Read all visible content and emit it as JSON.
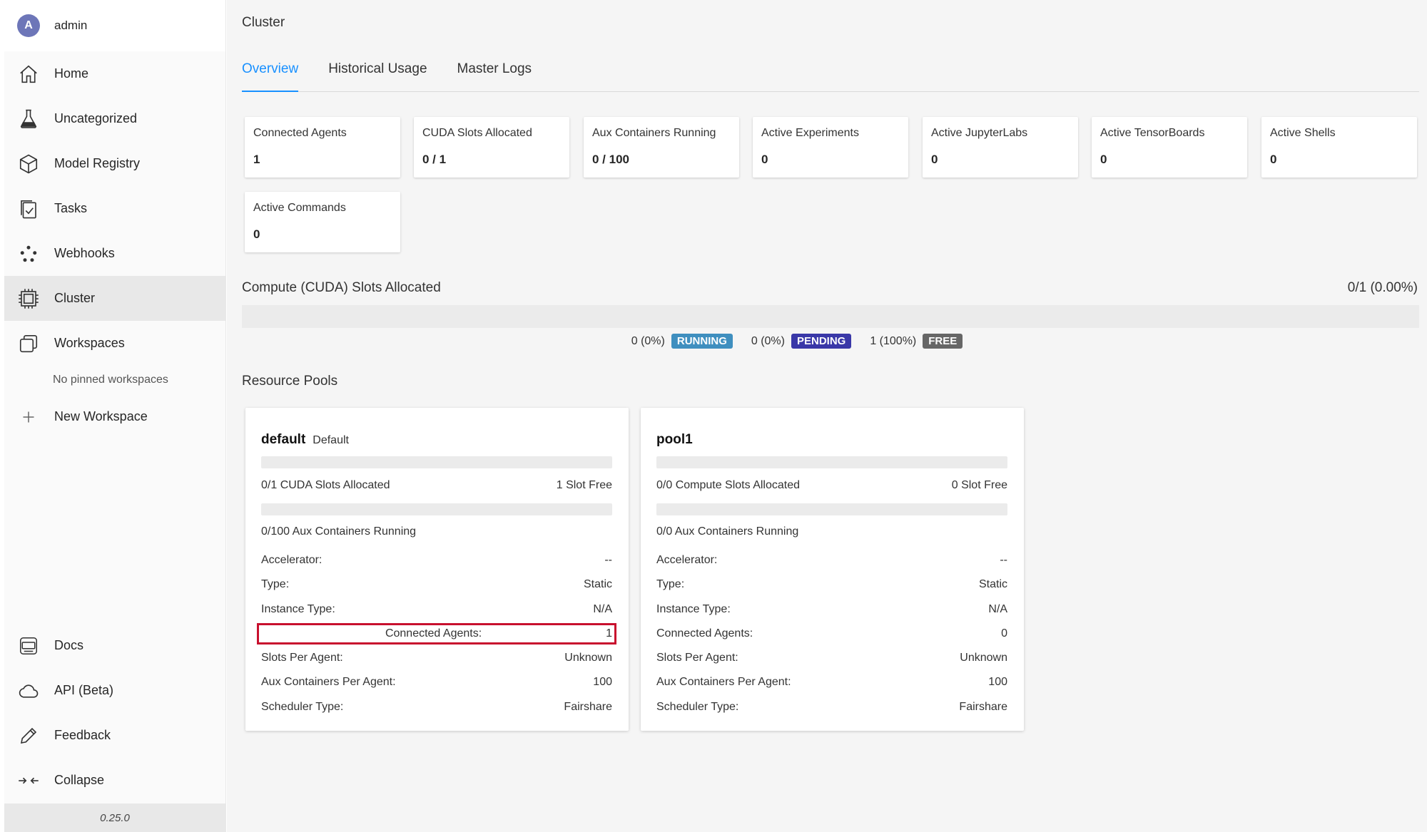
{
  "user": {
    "initial": "A",
    "name": "admin"
  },
  "sidebar": {
    "items": [
      {
        "label": "Home",
        "icon": "home-icon"
      },
      {
        "label": "Uncategorized",
        "icon": "flask-icon"
      },
      {
        "label": "Model Registry",
        "icon": "cube-icon"
      },
      {
        "label": "Tasks",
        "icon": "tasks-icon"
      },
      {
        "label": "Webhooks",
        "icon": "webhooks-icon"
      },
      {
        "label": "Cluster",
        "icon": "cpu-icon"
      },
      {
        "label": "Workspaces",
        "icon": "workspaces-icon"
      }
    ],
    "no_pinned": "No pinned workspaces",
    "new_workspace": "New Workspace",
    "bottom": [
      {
        "label": "Docs",
        "icon": "docs-icon"
      },
      {
        "label": "API (Beta)",
        "icon": "cloud-icon"
      },
      {
        "label": "Feedback",
        "icon": "pencil-icon"
      },
      {
        "label": "Collapse",
        "icon": "collapse-icon"
      }
    ],
    "version": "0.25.0"
  },
  "page": {
    "title": "Cluster",
    "tabs": [
      "Overview",
      "Historical Usage",
      "Master Logs"
    ]
  },
  "cards": [
    {
      "title": "Connected Agents",
      "value": "1"
    },
    {
      "title": "CUDA Slots Allocated",
      "value": "0 / 1"
    },
    {
      "title": "Aux Containers Running",
      "value": "0 / 100"
    },
    {
      "title": "Active Experiments",
      "value": "0"
    },
    {
      "title": "Active JupyterLabs",
      "value": "0"
    },
    {
      "title": "Active TensorBoards",
      "value": "0"
    },
    {
      "title": "Active Shells",
      "value": "0"
    },
    {
      "title": "Active Commands",
      "value": "0"
    }
  ],
  "allocation": {
    "title": "Compute (CUDA) Slots Allocated",
    "ratio": "0/1 (0.00%)",
    "legend": [
      {
        "count": "0 (0%)",
        "label": "RUNNING",
        "color": "#3f8fbf"
      },
      {
        "count": "0 (0%)",
        "label": "PENDING",
        "color": "#3a38a8"
      },
      {
        "count": "1 (100%)",
        "label": "FREE",
        "color": "#666666"
      }
    ]
  },
  "resource_pools": {
    "title": "Resource Pools",
    "pools": [
      {
        "name": "default",
        "tag": "Default",
        "slots_label": "0/1 CUDA Slots Allocated",
        "slots_free": "1 Slot Free",
        "aux_label": "0/100 Aux Containers Running",
        "details": [
          {
            "k": "Accelerator:",
            "v": "--"
          },
          {
            "k": "Type:",
            "v": "Static"
          },
          {
            "k": "Instance Type:",
            "v": "N/A"
          },
          {
            "k": "Connected Agents:",
            "v": "1"
          },
          {
            "k": "Slots Per Agent:",
            "v": "Unknown"
          },
          {
            "k": "Aux Containers Per Agent:",
            "v": "100"
          },
          {
            "k": "Scheduler Type:",
            "v": "Fairshare"
          }
        ]
      },
      {
        "name": "pool1",
        "tag": "",
        "slots_label": "0/0 Compute Slots Allocated",
        "slots_free": "0 Slot Free",
        "aux_label": "0/0 Aux Containers Running",
        "details": [
          {
            "k": "Accelerator:",
            "v": "--"
          },
          {
            "k": "Type:",
            "v": "Static"
          },
          {
            "k": "Instance Type:",
            "v": "N/A"
          },
          {
            "k": "Connected Agents:",
            "v": "0"
          },
          {
            "k": "Slots Per Agent:",
            "v": "Unknown"
          },
          {
            "k": "Aux Containers Per Agent:",
            "v": "100"
          },
          {
            "k": "Scheduler Type:",
            "v": "Fairshare"
          }
        ]
      }
    ]
  }
}
